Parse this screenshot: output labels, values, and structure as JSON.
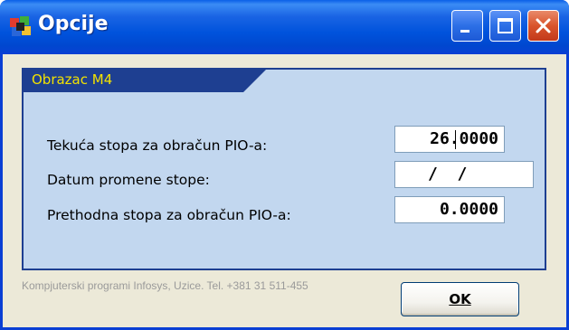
{
  "window": {
    "title": "Opcije"
  },
  "group": {
    "title": "Obrazac M4"
  },
  "fields": {
    "current_rate_label": "Tekuća stopa za obračun PIO-a:",
    "current_rate_value": "26.0000",
    "change_date_label": "Datum promene stope:",
    "change_date_value": "/  /",
    "previous_rate_label": "Prethodna stopa za obračun PIO-a:",
    "previous_rate_value": "0.0000"
  },
  "footer": {
    "copyright": "Kompjuterski programi Infosys, Uzice. Tel. +381 31 511-455"
  },
  "buttons": {
    "ok_label": "OK"
  },
  "icons": {
    "app": "colorful-app-icon",
    "minimize": "minimize-icon",
    "maximize": "maximize-icon",
    "close": "close-icon"
  },
  "colors": {
    "titlebar": "#0053dc",
    "group_bg": "#c2d7ef",
    "group_header": "#1e3f91",
    "group_title": "#f3e200",
    "window_bg": "#ece9d8",
    "close_button": "#d9542b"
  }
}
